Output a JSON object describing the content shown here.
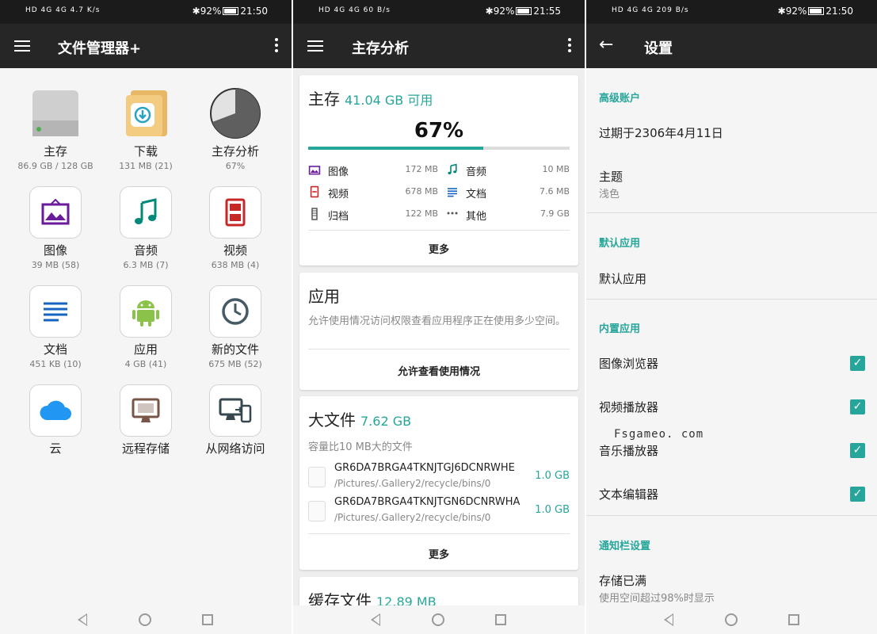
{
  "colors": {
    "accent": "#26a69a",
    "appbar": "#262626",
    "statusbar": "#1b1b1b"
  },
  "panel1": {
    "status": {
      "left": "HD 4G 4G 4.7 K/s",
      "right": "92%",
      "time": "21:50"
    },
    "title": "文件管理器+",
    "items": [
      {
        "label": "主存",
        "sub": "86.9 GB / 128 GB",
        "icon": "storage-drive-icon"
      },
      {
        "label": "下载",
        "sub": "131 MB (21)",
        "icon": "download-folder-icon"
      },
      {
        "label": "主存分析",
        "sub": "67%",
        "icon": "pie-chart-icon"
      },
      {
        "label": "图像",
        "sub": "39 MB (58)",
        "icon": "image-icon"
      },
      {
        "label": "音频",
        "sub": "6.3 MB (7)",
        "icon": "music-note-icon"
      },
      {
        "label": "视频",
        "sub": "638 MB (4)",
        "icon": "film-icon"
      },
      {
        "label": "文档",
        "sub": "451 KB (10)",
        "icon": "document-lines-icon"
      },
      {
        "label": "应用",
        "sub": "4 GB (41)",
        "icon": "android-icon"
      },
      {
        "label": "新的文件",
        "sub": "675 MB (52)",
        "icon": "clock-icon"
      },
      {
        "label": "云",
        "sub": "",
        "icon": "cloud-icon"
      },
      {
        "label": "远程存储",
        "sub": "",
        "icon": "monitor-icon"
      },
      {
        "label": "从网络访问",
        "sub": "",
        "icon": "network-devices-icon"
      }
    ]
  },
  "panel2": {
    "status": {
      "left": "HD 4G 4G 60 B/s",
      "right": "92%",
      "time": "21:55"
    },
    "title": "主存分析",
    "storage": {
      "title": "主存",
      "available": "41.04 GB 可用",
      "percent_label": "67%",
      "used_fraction": 0.67,
      "stats": [
        {
          "label": "图像",
          "value": "172 MB",
          "icon": "image-icon",
          "color": "#6a1b9a"
        },
        {
          "label": "音频",
          "value": "10 MB",
          "icon": "music-note-icon",
          "color": "#00897b"
        },
        {
          "label": "视频",
          "value": "678 MB",
          "icon": "film-icon",
          "color": "#c62828"
        },
        {
          "label": "文档",
          "value": "7.6 MB",
          "icon": "document-lines-icon",
          "color": "#1565c0"
        },
        {
          "label": "归档",
          "value": "122 MB",
          "icon": "archive-icon",
          "color": "#555555"
        },
        {
          "label": "其他",
          "value": "7.9 GB",
          "icon": "more-dots-icon",
          "color": "#555555"
        }
      ],
      "more": "更多"
    },
    "apps": {
      "title": "应用",
      "desc": "允许使用情况访问权限查看应用程序正在使用多少空间。",
      "action": "允许查看使用情况"
    },
    "large": {
      "title": "大文件",
      "size": "7.62 GB",
      "desc": "容量比10 MB大的文件",
      "files": [
        {
          "name": "GR6DA7BRGA4TKNJTGJ6DCNRWHE",
          "path": "/Pictures/.Gallery2/recycle/bins/0",
          "size": "1.0 GB"
        },
        {
          "name": "GR6DA7BRGA4TKNJTGN6DCNRWHA",
          "path": "/Pictures/.Gallery2/recycle/bins/0",
          "size": "1.0 GB"
        }
      ],
      "more": "更多"
    },
    "cache": {
      "title": "缓存文件",
      "size": "12.89 MB"
    }
  },
  "panel3": {
    "status": {
      "left": "HD 4G 4G 209 B/s",
      "right": "92%",
      "time": "21:50"
    },
    "title": "设置",
    "sections": {
      "premium": "高级账户",
      "expiry": "过期于2306年4月11日",
      "theme_title": "主题",
      "theme_value": "浅色",
      "default_apps_head": "默认应用",
      "default_apps": "默认应用",
      "builtin_head": "内置应用",
      "builtin": [
        {
          "label": "图像浏览器",
          "checked": true
        },
        {
          "label": "视频播放器",
          "checked": true
        },
        {
          "label": "音乐播放器",
          "checked": true
        },
        {
          "label": "文本编辑器",
          "checked": true
        }
      ],
      "notif_head": "通知栏设置",
      "storage_full": "存储已满",
      "storage_full_sub": "使用空间超过98%时显示"
    },
    "watermark": "Fsgameo. com"
  }
}
